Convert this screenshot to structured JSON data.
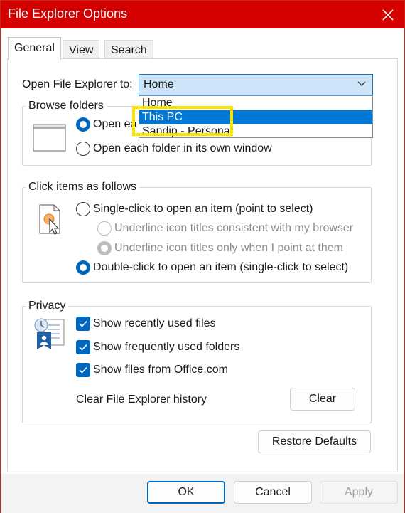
{
  "window": {
    "title": "File Explorer Options"
  },
  "tabs": [
    {
      "label": "General"
    },
    {
      "label": "View"
    },
    {
      "label": "Search"
    }
  ],
  "open_to": {
    "label": "Open File Explorer to:",
    "selected": "Home",
    "options": [
      "Home",
      "This PC",
      "Sandip - Personal"
    ],
    "highlighted": "This PC"
  },
  "browse": {
    "title": "Browse folders",
    "option_same": "Open each folder in the same window",
    "option_same_visible": "Open ea",
    "option_own": "Open each folder in its own window"
  },
  "click": {
    "title": "Click items as follows",
    "single": "Single-click to open an item (point to select)",
    "underline_browser": "Underline icon titles consistent with my browser",
    "underline_point": "Underline icon titles only when I point at them",
    "double": "Double-click to open an item (single-click to select)"
  },
  "privacy": {
    "title": "Privacy",
    "recent_files": "Show recently used files",
    "frequent_folders": "Show frequently used folders",
    "office_files": "Show files from Office.com",
    "clear_label": "Clear File Explorer history",
    "clear_button": "Clear"
  },
  "restore_defaults": "Restore Defaults",
  "footer": {
    "ok": "OK",
    "cancel": "Cancel",
    "apply": "Apply"
  },
  "colors": {
    "accent": "#0067c0",
    "titlebar": "#d50000",
    "highlight": "#f7e400",
    "dropdown_selected": "#0078d7"
  }
}
